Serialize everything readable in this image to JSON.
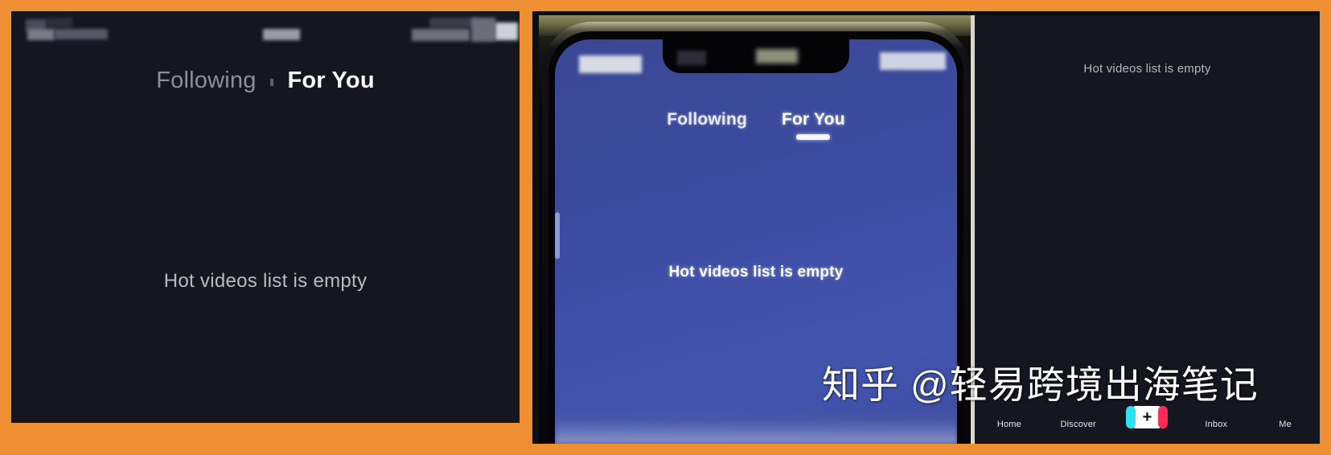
{
  "frame": {
    "accent_color": "#ef8f33"
  },
  "left_panel": {
    "name": "app-screenshot-dark",
    "background_color": "#15161f",
    "tabs": {
      "following_label": "Following",
      "for_you_label": "For You",
      "active": "For You"
    },
    "empty_state": "Hot videos list is empty",
    "status_bar_redacted": true
  },
  "photo_panel": {
    "name": "photo-of-phone",
    "phone_screen": {
      "background_color": "#3f4ea6",
      "tabs": {
        "following_label": "Following",
        "for_you_label": "For You",
        "active": "For You"
      },
      "empty_state": "Hot videos list is empty",
      "status_bar_redacted": true
    },
    "capture_panel": {
      "background_color": "#15161f",
      "empty_state": "Hot videos list is empty",
      "nav": {
        "items": [
          {
            "label": "Home",
            "icon": "home-icon",
            "active": true
          },
          {
            "label": "Discover",
            "icon": "search-icon",
            "active": false
          },
          {
            "label": "",
            "icon": "plus-icon",
            "active": false
          },
          {
            "label": "Inbox",
            "icon": "inbox-icon",
            "active": false
          },
          {
            "label": "Me",
            "icon": "profile-icon",
            "active": false
          }
        ],
        "plus_colors": {
          "left": "#2ae3ef",
          "right": "#fe2c55",
          "center": "#ffffff"
        }
      }
    }
  },
  "watermark": {
    "text": "知乎 @轻易跨境出海笔记"
  }
}
